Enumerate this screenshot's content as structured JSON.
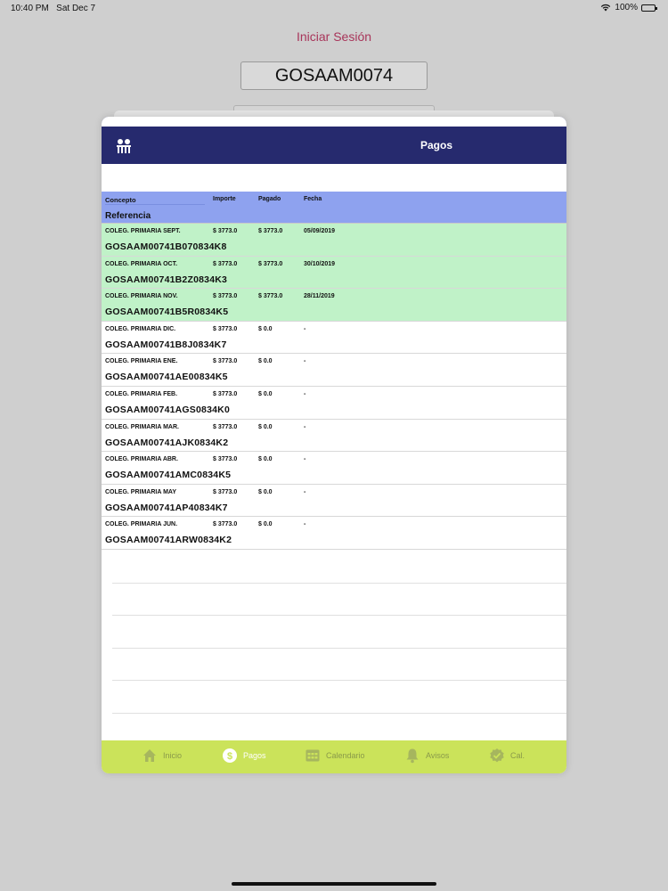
{
  "status_bar": {
    "time": "10:40 PM",
    "date": "Sat Dec 7",
    "battery": "100%"
  },
  "background": {
    "title": "Iniciar Sesión",
    "username": "GOSAAM0074"
  },
  "nav": {
    "title": "Pagos"
  },
  "table": {
    "headers": {
      "concepto": "Concepto",
      "importe": "Importe",
      "pagado": "Pagado",
      "fecha": "Fecha",
      "referencia": "Referencia"
    },
    "rows": [
      {
        "concepto": "COLEG. PRIMARIA SEPT.",
        "importe": "$ 3773.0",
        "pagado": "$ 3773.0",
        "fecha": "05/09/2019",
        "referencia": "GOSAAM00741B070834K8",
        "paid": true
      },
      {
        "concepto": "COLEG. PRIMARIA OCT.",
        "importe": "$ 3773.0",
        "pagado": "$ 3773.0",
        "fecha": "30/10/2019",
        "referencia": "GOSAAM00741B2Z0834K3",
        "paid": true
      },
      {
        "concepto": "COLEG. PRIMARIA NOV.",
        "importe": "$ 3773.0",
        "pagado": "$ 3773.0",
        "fecha": "28/11/2019",
        "referencia": "GOSAAM00741B5R0834K5",
        "paid": true
      },
      {
        "concepto": "COLEG. PRIMARIA DIC.",
        "importe": "$ 3773.0",
        "pagado": "$ 0.0",
        "fecha": "-",
        "referencia": "GOSAAM00741B8J0834K7",
        "paid": false
      },
      {
        "concepto": "COLEG. PRIMARIA ENE.",
        "importe": "$ 3773.0",
        "pagado": "$ 0.0",
        "fecha": "-",
        "referencia": "GOSAAM00741AE00834K5",
        "paid": false
      },
      {
        "concepto": "COLEG. PRIMARIA FEB.",
        "importe": "$ 3773.0",
        "pagado": "$ 0.0",
        "fecha": "-",
        "referencia": "GOSAAM00741AGS0834K0",
        "paid": false
      },
      {
        "concepto": "COLEG. PRIMARIA MAR.",
        "importe": "$ 3773.0",
        "pagado": "$ 0.0",
        "fecha": "-",
        "referencia": "GOSAAM00741AJK0834K2",
        "paid": false
      },
      {
        "concepto": "COLEG. PRIMARIA ABR.",
        "importe": "$ 3773.0",
        "pagado": "$ 0.0",
        "fecha": "-",
        "referencia": "GOSAAM00741AMC0834K5",
        "paid": false
      },
      {
        "concepto": "COLEG. PRIMARIA MAY",
        "importe": "$ 3773.0",
        "pagado": "$ 0.0",
        "fecha": "-",
        "referencia": "GOSAAM00741AP40834K7",
        "paid": false
      },
      {
        "concepto": "COLEG. PRIMARIA JUN.",
        "importe": "$ 3773.0",
        "pagado": "$ 0.0",
        "fecha": "-",
        "referencia": "GOSAAM00741ARW0834K2",
        "paid": false
      }
    ]
  },
  "tab_bar": {
    "items": [
      {
        "label": "Inicio",
        "icon": "home-icon",
        "active": false
      },
      {
        "label": "Pagos",
        "icon": "dollar-icon",
        "active": true
      },
      {
        "label": "Calendario",
        "icon": "calendar-icon",
        "active": false
      },
      {
        "label": "Avisos",
        "icon": "bell-icon",
        "active": false
      },
      {
        "label": "Cal.",
        "icon": "badge-check-icon",
        "active": false
      }
    ]
  },
  "colors": {
    "nav": "#262a6e",
    "header": "#8ea2ef",
    "paid_row": "#c0f2c8",
    "tab_bar": "#cbe35a",
    "title_accent": "#a8355a"
  }
}
